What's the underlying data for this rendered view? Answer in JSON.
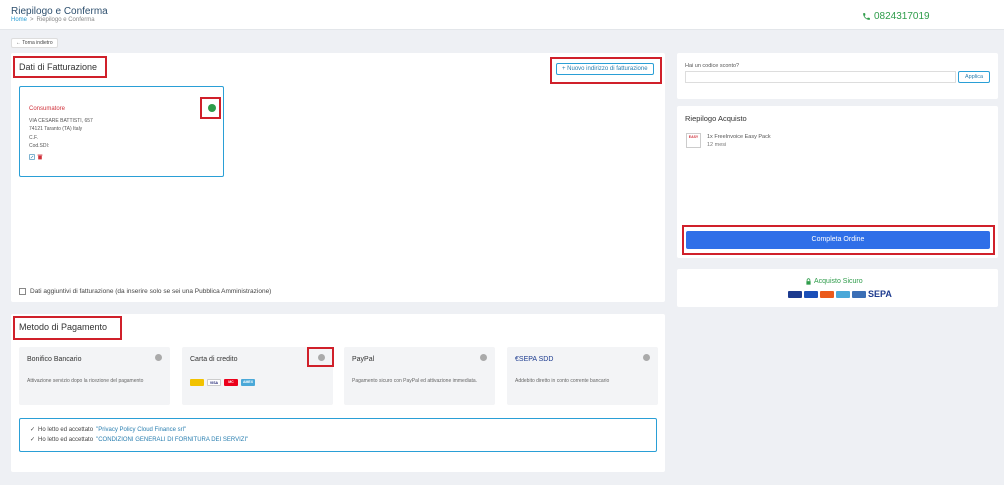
{
  "header": {
    "title": "Riepilogo e Conferma",
    "breadcrumb_home": "Home",
    "breadcrumb_sep": ">",
    "breadcrumb_current": "Riepilogo e Conferma",
    "phone": "0824317019"
  },
  "back_label": "← Torna indietro",
  "billing": {
    "title": "Dati di Fatturazione",
    "new_address_button": "+ Nuovo indirizzo di fatturazione",
    "card": {
      "name": "Consumatore",
      "address": "VIA CESARE BATTISTI, 657",
      "city": "74121 Taranto (TA) Italy",
      "cf": "C.F.",
      "sdi": "Cod.SDI:"
    },
    "extra_checkbox_label": "Dati aggiuntivi di fatturazione (da inserire solo se sei una Pubblica Amministrazione)"
  },
  "payment": {
    "title": "Metodo di Pagamento",
    "methods": [
      {
        "title": "Bonifico Bancario",
        "desc": "Attivazione servizio dopo la ricezione del pagamento"
      },
      {
        "title": "Carta di credito",
        "desc": ""
      },
      {
        "title": "PayPal",
        "desc": "Pagamento sicuro con PayPal ed attivazione immediata."
      },
      {
        "title": "SEPA SDD",
        "desc": "Addebito diretto in conto corrente bancario"
      }
    ],
    "card_logos": [
      "VISA",
      "MC",
      "AMEX"
    ],
    "accept": {
      "line1_prefix": "Ho letto ed accettato",
      "line1_link": "\"Privacy Policy Cloud Finance srl\"",
      "line2_prefix": "Ho letto ed accettato",
      "line2_link": "\"CONDIZIONI GENERALI DI FORNITURA DEI SERVIZI\""
    }
  },
  "discount": {
    "label": "Hai un codice sconto?",
    "placeholder": "",
    "apply_button": "Applica"
  },
  "summary": {
    "title": "Riepilogo Acquisto",
    "product_name": "1x FreeInvoice Easy Pack",
    "product_duration": "12 mesi",
    "thumb_label": "EASY",
    "complete_button": "Completa Ordine"
  },
  "secure": {
    "label": "Acquisto Sicuro",
    "sepa": "SEPA"
  },
  "colors": {
    "accent": "#2a9fd6",
    "primary_button": "#2f6fe8",
    "success": "#2e9c4a",
    "annotation": "#d0202a"
  }
}
